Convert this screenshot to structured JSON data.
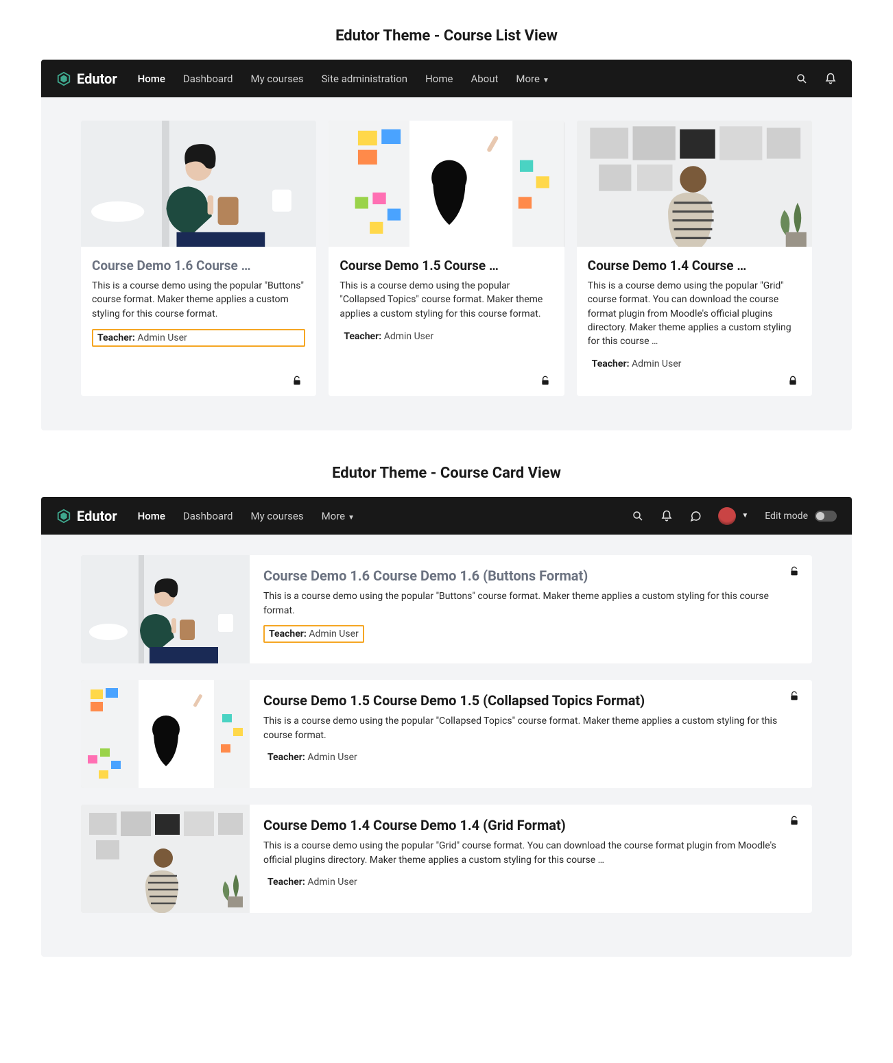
{
  "section1_title": "Edutor Theme - Course List View",
  "section2_title": "Edutor Theme - Course Card View",
  "brand": "Edutor",
  "nav1": {
    "items": [
      "Home",
      "Dashboard",
      "My courses",
      "Site administration",
      "Home",
      "About",
      "More"
    ],
    "active": "Home"
  },
  "nav2": {
    "items": [
      "Home",
      "Dashboard",
      "My courses",
      "More"
    ],
    "active": "Home",
    "editmode_label": "Edit mode"
  },
  "teacher_label": "Teacher:",
  "courses_grid": [
    {
      "title": "Course Demo 1.6 Course …",
      "muted": true,
      "desc": "This is a course demo using the popular \"Buttons\" course format. Maker theme applies a custom styling for this course format.",
      "teacher": "Admin User",
      "highlighted": true,
      "locked": "unlocked"
    },
    {
      "title": "Course Demo 1.5 Course …",
      "muted": false,
      "desc": "This is a course demo using the popular \"Collapsed Topics\" course format. Maker theme applies a custom styling for this course format.",
      "teacher": "Admin User",
      "highlighted": false,
      "locked": "unlocked"
    },
    {
      "title": "Course Demo 1.4 Course …",
      "muted": false,
      "desc": "This is a course demo using the popular \"Grid\" course format. You can download the course format plugin from Moodle's official plugins directory. Maker theme applies a custom styling for this course …",
      "teacher": "Admin User",
      "highlighted": false,
      "locked": "locked"
    }
  ],
  "courses_list": [
    {
      "title": "Course Demo 1.6 Course Demo 1.6 (Buttons Format)",
      "muted": true,
      "desc": "This is a course demo using the popular \"Buttons\" course format. Maker theme applies a custom styling for this course format.",
      "teacher": "Admin User",
      "highlighted": true,
      "locked": "unlocked"
    },
    {
      "title": "Course Demo 1.5 Course Demo 1.5 (Collapsed Topics Format)",
      "muted": false,
      "desc": "This is a course demo using the popular \"Collapsed Topics\" course format. Maker theme applies a custom styling for this course format.",
      "teacher": "Admin User",
      "highlighted": false,
      "locked": "unlocked"
    },
    {
      "title": "Course Demo 1.4 Course Demo 1.4 (Grid Format)",
      "muted": false,
      "desc": "This is a course demo using the popular \"Grid\" course format. You can download the course format plugin from Moodle's official plugins directory. Maker theme applies a custom styling for this course …",
      "teacher": "Admin User",
      "highlighted": false,
      "locked": "unlocked"
    }
  ]
}
